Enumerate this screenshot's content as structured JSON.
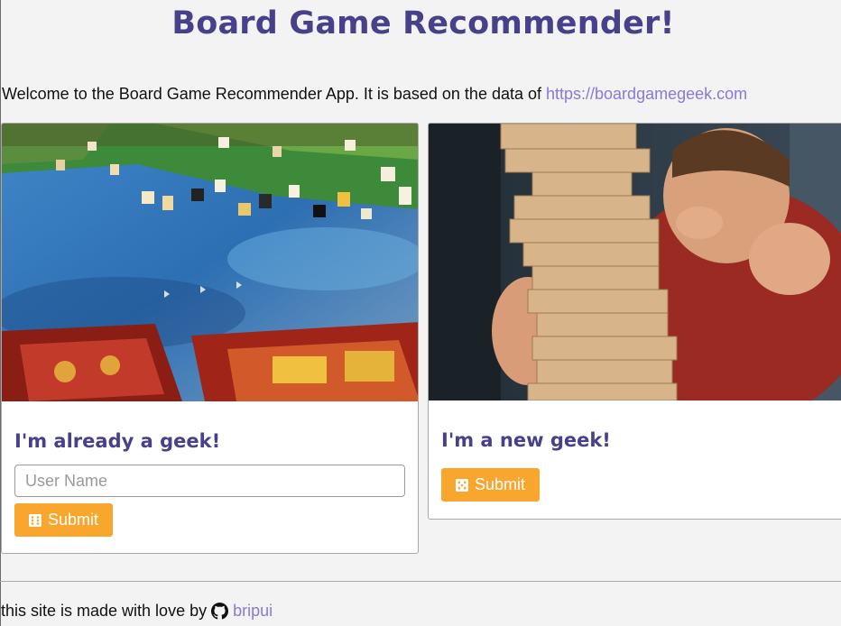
{
  "header": {
    "title": "Board Game Recommender!"
  },
  "intro": {
    "text": "Welcome to the Board Game Recommender App. It is based on the data of ",
    "link_text": "https://boardgamegeek.com"
  },
  "cards": {
    "geek": {
      "image_icon": "board-game-photo",
      "title": "I'm already a geek!",
      "username_placeholder": "User Name",
      "username_value": "",
      "submit_label": "Submit",
      "submit_icon": "dice-six-icon"
    },
    "new": {
      "image_icon": "jenga-tower-photo",
      "title": "I'm a new geek!",
      "submit_label": "Submit",
      "submit_icon": "dice-five-icon"
    }
  },
  "footer": {
    "text": "this site is made with love by",
    "author": "bripui",
    "author_icon": "github-icon"
  },
  "colors": {
    "accent": "#47408a",
    "link": "#8a79d6",
    "button": "#f9a62f",
    "background": "#f3f3f3"
  }
}
